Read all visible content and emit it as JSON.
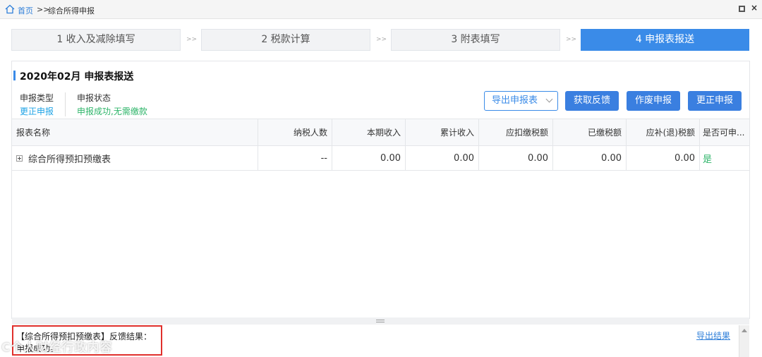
{
  "breadcrumb": {
    "home": "首页",
    "separator": ">>",
    "current": "综合所得申报"
  },
  "steps": [
    {
      "label": "1 收入及减除填写"
    },
    {
      "label": "2 税款计算"
    },
    {
      "label": "3 附表填写"
    },
    {
      "label": "4 申报表报送"
    }
  ],
  "step_arrow": ">>",
  "active_step": 4,
  "section": {
    "title": "2020年02月  申报表报送",
    "report_type_label": "申报类型",
    "report_type_value": "更正申报",
    "status_label": "申报状态",
    "status_value": "申报成功,无需缴款"
  },
  "actions": {
    "export_report": "导出申报表",
    "get_feedback": "获取反馈",
    "void_report": "作废申报",
    "correct_report": "更正申报"
  },
  "table": {
    "headers": [
      "报表名称",
      "纳税人数",
      "本期收入",
      "累计收入",
      "应扣缴税额",
      "已缴税额",
      "应补(退)税额",
      "是否可申..."
    ],
    "rows": [
      {
        "name": "综合所得预扣预缴表",
        "taxpayers": "--",
        "current_income": "0.00",
        "cumulative_income": "0.00",
        "tax_withheld": "0.00",
        "tax_paid": "0.00",
        "tax_due": "0.00",
        "can_apply": "是"
      }
    ]
  },
  "feedback": {
    "line1": "【综合所得预扣预缴表】反馈结果：",
    "line2": "申报成功。",
    "export_link": "导出结果"
  },
  "watermark": "C个人财经行政内容"
}
